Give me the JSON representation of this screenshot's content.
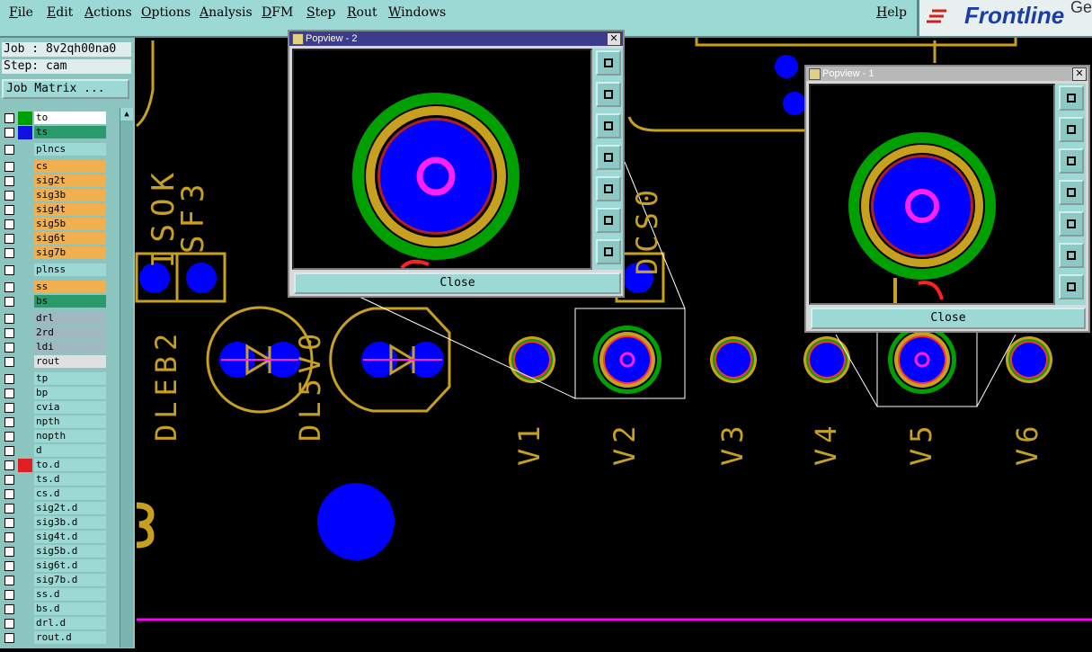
{
  "menubar": {
    "items": [
      "File",
      "Edit",
      "Actions",
      "Options",
      "Analysis",
      "DFM",
      "Step",
      "Rout",
      "Windows"
    ],
    "help": "Help"
  },
  "logo": {
    "text": "Frontline",
    "extra": "Ge"
  },
  "job_info": {
    "job": "Job : 8v2qh00na0",
    "step": "Step: cam"
  },
  "job_matrix_label": "Job Matrix ...",
  "layers": [
    {
      "name": "to",
      "color": "#ffffff",
      "swatch": "#00a000",
      "active": true
    },
    {
      "name": "ts",
      "color": "#2a9a6a",
      "swatch": "#1010e0"
    },
    {
      "name": "plncs",
      "color": "#9cd8d4",
      "swatch": ""
    },
    {
      "name": "cs",
      "color": "#f0b050",
      "swatch": ""
    },
    {
      "name": "sig2t",
      "color": "#f0b050",
      "swatch": ""
    },
    {
      "name": "sig3b",
      "color": "#f0b050",
      "swatch": ""
    },
    {
      "name": "sig4t",
      "color": "#f0b050",
      "swatch": ""
    },
    {
      "name": "sig5b",
      "color": "#f0b050",
      "swatch": ""
    },
    {
      "name": "sig6t",
      "color": "#f0b050",
      "swatch": ""
    },
    {
      "name": "sig7b",
      "color": "#f0b050",
      "swatch": ""
    },
    {
      "name": "plnss",
      "color": "#9cd8d4",
      "swatch": ""
    },
    {
      "name": "ss",
      "color": "#f0b050",
      "swatch": ""
    },
    {
      "name": "bs",
      "color": "#2a9a6a",
      "swatch": ""
    },
    {
      "name": "drl",
      "color": "#a0b8c0",
      "swatch": ""
    },
    {
      "name": "2rd",
      "color": "#a0b8c0",
      "swatch": ""
    },
    {
      "name": "ldi",
      "color": "#a0b8c0",
      "swatch": ""
    },
    {
      "name": "rout",
      "color": "#e0e0e0",
      "swatch": ""
    },
    {
      "name": "tp",
      "color": "#9cd8d4",
      "swatch": ""
    },
    {
      "name": "bp",
      "color": "#9cd8d4",
      "swatch": ""
    },
    {
      "name": "cvia",
      "color": "#9cd8d4",
      "swatch": ""
    },
    {
      "name": "npth",
      "color": "#9cd8d4",
      "swatch": ""
    },
    {
      "name": "nopth",
      "color": "#9cd8d4",
      "swatch": ""
    },
    {
      "name": "d",
      "color": "#9cd8d4",
      "swatch": ""
    },
    {
      "name": "to.d",
      "color": "#9cd8d4",
      "swatch": "#e02020"
    },
    {
      "name": "ts.d",
      "color": "#9cd8d4",
      "swatch": ""
    },
    {
      "name": "cs.d",
      "color": "#9cd8d4",
      "swatch": ""
    },
    {
      "name": "sig2t.d",
      "color": "#9cd8d4",
      "swatch": ""
    },
    {
      "name": "sig3b.d",
      "color": "#9cd8d4",
      "swatch": ""
    },
    {
      "name": "sig4t.d",
      "color": "#9cd8d4",
      "swatch": ""
    },
    {
      "name": "sig5b.d",
      "color": "#9cd8d4",
      "swatch": ""
    },
    {
      "name": "sig6t.d",
      "color": "#9cd8d4",
      "swatch": ""
    },
    {
      "name": "sig7b.d",
      "color": "#9cd8d4",
      "swatch": ""
    },
    {
      "name": "ss.d",
      "color": "#9cd8d4",
      "swatch": ""
    },
    {
      "name": "bs.d",
      "color": "#9cd8d4",
      "swatch": ""
    },
    {
      "name": "drl.d",
      "color": "#9cd8d4",
      "swatch": ""
    },
    {
      "name": "rout.d",
      "color": "#9cd8d4",
      "swatch": ""
    }
  ],
  "labels": {
    "isok": "ISOK",
    "sf3": "SF3",
    "dleb2": "DLEB2",
    "dl5v0": "DL5V0",
    "dcs0": "DCS0",
    "v1": "V1",
    "v2": "V2",
    "v3": "V3",
    "v4": "V4",
    "v5": "V5",
    "v6": "V6"
  },
  "popview2": {
    "title": "Popview - 2",
    "close": "Close"
  },
  "popview1": {
    "title": "Popview - 1",
    "close": "Close"
  },
  "colors": {
    "pad": "#0000ff",
    "silk": "#c8a020",
    "ring": "#00a000",
    "drill": "#ff20ff",
    "rout": "#ff00ff"
  }
}
